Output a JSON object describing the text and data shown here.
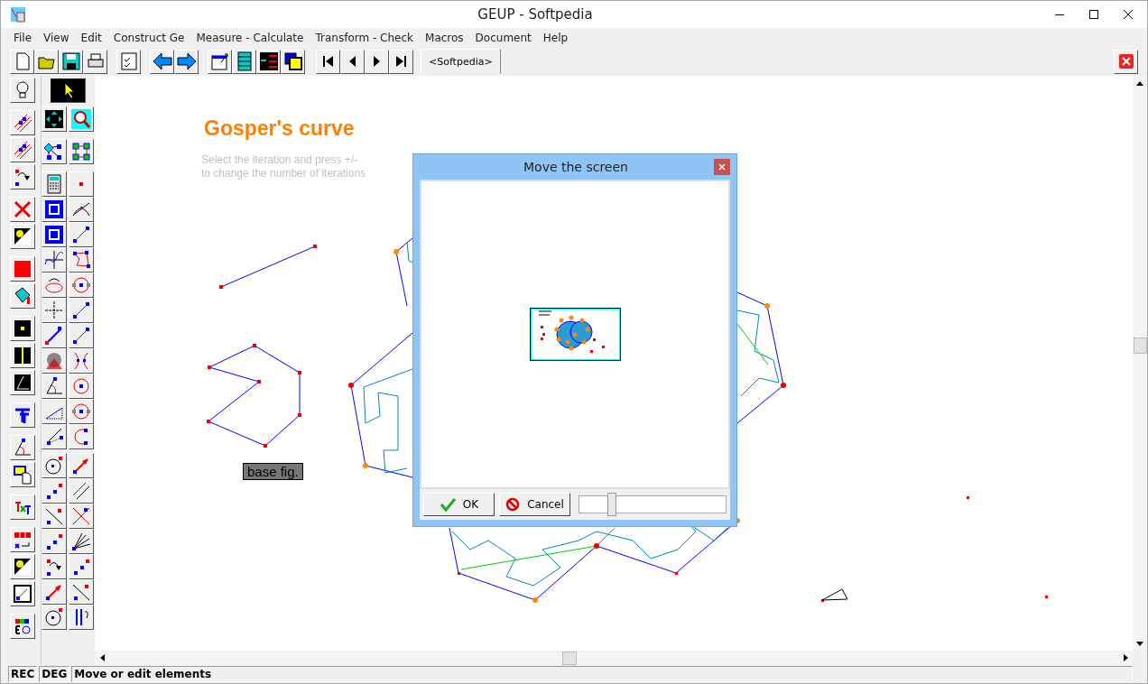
{
  "window": {
    "title": "GEUP - Softpedia"
  },
  "menu": [
    "File",
    "View",
    "Edit",
    "Construct Ge",
    "Measure - Calculate",
    "Transform - Check",
    "Macros",
    "Document",
    "Help"
  ],
  "toolbar": {
    "tab": "<Softpedia>"
  },
  "canvas": {
    "title": "Gosper's curve",
    "hint": [
      "Select the iteration and press +/-",
      "to change the number of iterations"
    ],
    "label": "base fig."
  },
  "dialog": {
    "title": "Move the screen",
    "buttons": [
      {
        "label": "OK",
        "kind": "ok"
      },
      {
        "label": "Cancel",
        "kind": "cancel"
      }
    ],
    "zoom": {
      "level": 0.22
    }
  },
  "status_bar": [
    "REC",
    "DEG",
    "Move or edit elements"
  ]
}
